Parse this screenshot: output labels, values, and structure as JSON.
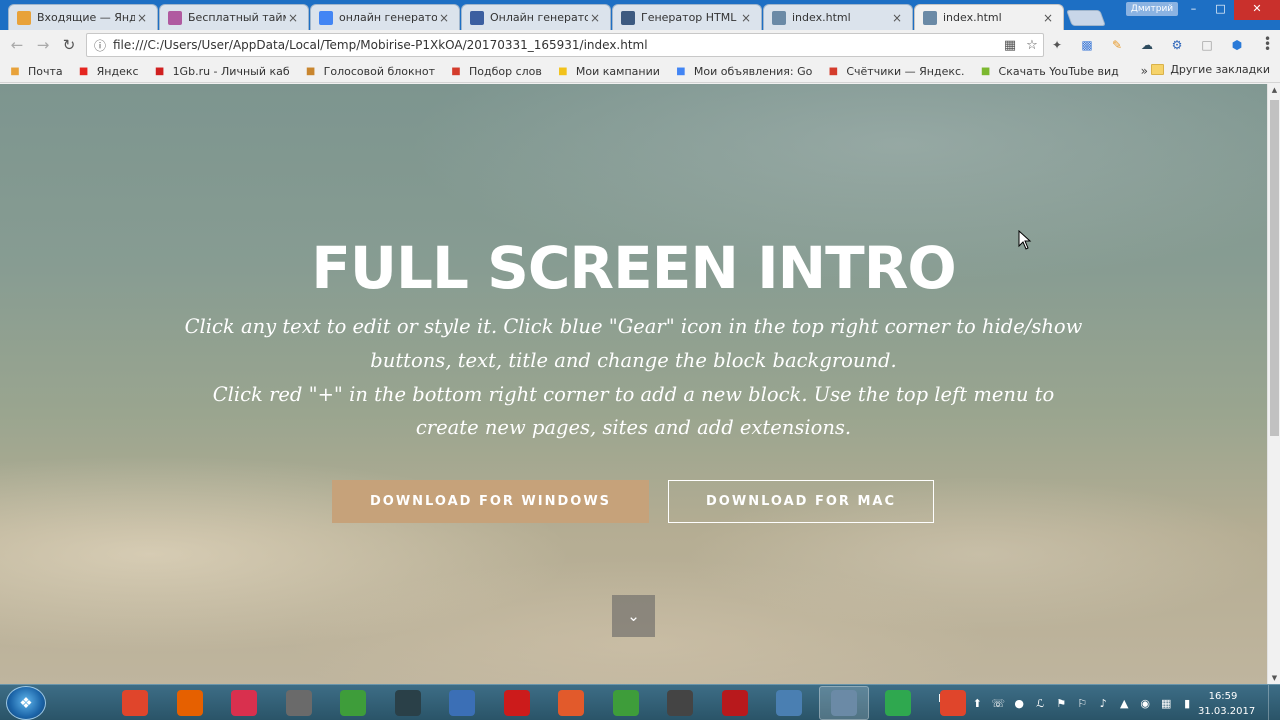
{
  "browser": {
    "profile_name": "Дмитрий",
    "tabs": [
      {
        "title": "Входящие — Яндекс.Почта",
        "favicon": "mail-icon",
        "color": "#e8a23a",
        "active": false
      },
      {
        "title": "Бесплатный таймер",
        "favicon": "timer-icon",
        "color": "#b05aa0",
        "active": false
      },
      {
        "title": "онлайн генератор html",
        "favicon": "google-icon",
        "color": "#4285f4",
        "active": false
      },
      {
        "title": "Онлайн генератор",
        "favicon": "page-icon",
        "color": "#3c5fa0",
        "active": false
      },
      {
        "title": "Генератор HTML",
        "favicon": "site-icon",
        "color": "#3d5a80",
        "active": false
      },
      {
        "title": "index.html",
        "favicon": "mobirise-icon",
        "color": "#6b8aa6",
        "active": false
      },
      {
        "title": "index.html",
        "favicon": "mobirise-icon",
        "color": "#6b8aa6",
        "active": true
      }
    ],
    "url": "file:///C:/Users/User/AppData/Local/Temp/Mobirise-P1XkOA/20170331_165931/index.html",
    "bookmarks": [
      {
        "label": "Почта",
        "icon": "mail-icon",
        "color": "#e8a23a"
      },
      {
        "label": "Яндекс",
        "icon": "yandex-icon",
        "color": "#e52620"
      },
      {
        "label": "1Gb.ru - Личный каб",
        "icon": "1gb-icon",
        "color": "#d02020"
      },
      {
        "label": "Голосовой блокнот",
        "icon": "palette-icon",
        "color": "#c9862f"
      },
      {
        "label": "Подбор слов",
        "icon": "chart-icon",
        "color": "#d43c2c"
      },
      {
        "label": "Мои кампании",
        "icon": "direct-icon",
        "color": "#f2c21b"
      },
      {
        "label": "Мои объявления: Go",
        "icon": "google-icon",
        "color": "#4285f4"
      },
      {
        "label": "Счётчики — Яндекс.",
        "icon": "metrika-icon",
        "color": "#d43c2c"
      },
      {
        "label": "Скачать YouTube вид",
        "icon": "download-icon",
        "color": "#7cb82f"
      }
    ],
    "bookmarks_more": "»",
    "other_bookmarks": "Другие закладки"
  },
  "page": {
    "title": "FULL SCREEN INTRO",
    "text_line1": "Click any text to edit or style it. Click blue \"Gear\" icon in the top right corner to hide/show buttons, text, title and change the block background.",
    "text_line2": "Click red \"+\" in the bottom right corner to add a new block. Use the top left menu to create new pages, sites and add extensions.",
    "btn_windows": "DOWNLOAD FOR WINDOWS",
    "btn_mac": "DOWNLOAD FOR MAC",
    "accent": "#c6a27a"
  },
  "taskbar": {
    "apps": [
      {
        "name": "microsoft-icon",
        "color": "#e0452b"
      },
      {
        "name": "firefox-icon",
        "color": "#e66000"
      },
      {
        "name": "pocket-icon",
        "color": "#d9304e"
      },
      {
        "name": "mascot-icon",
        "color": "#6a6a6a"
      },
      {
        "name": "chrome-icon",
        "color": "#3e9d3a"
      },
      {
        "name": "nox-icon",
        "color": "#2a4048"
      },
      {
        "name": "thunderbird-icon",
        "color": "#3b6fb6"
      },
      {
        "name": "opera-icon",
        "color": "#cc1b1b"
      },
      {
        "name": "app-circle-icon",
        "color": "#e25a2b"
      },
      {
        "name": "chrome-icon",
        "color": "#3e9d3a"
      },
      {
        "name": "camera-icon",
        "color": "#444444"
      },
      {
        "name": "filezilla-icon",
        "color": "#b8191c"
      },
      {
        "name": "hand-icon",
        "color": "#4a7fb2"
      },
      {
        "name": "mobirise-icon",
        "color": "#6b8aa6"
      },
      {
        "name": "camtasia-icon",
        "color": "#2fa84f"
      },
      {
        "name": "app-c-icon",
        "color": "#e0452b"
      }
    ],
    "lang": "RU",
    "time": "16:59",
    "date": "31.03.2017"
  }
}
